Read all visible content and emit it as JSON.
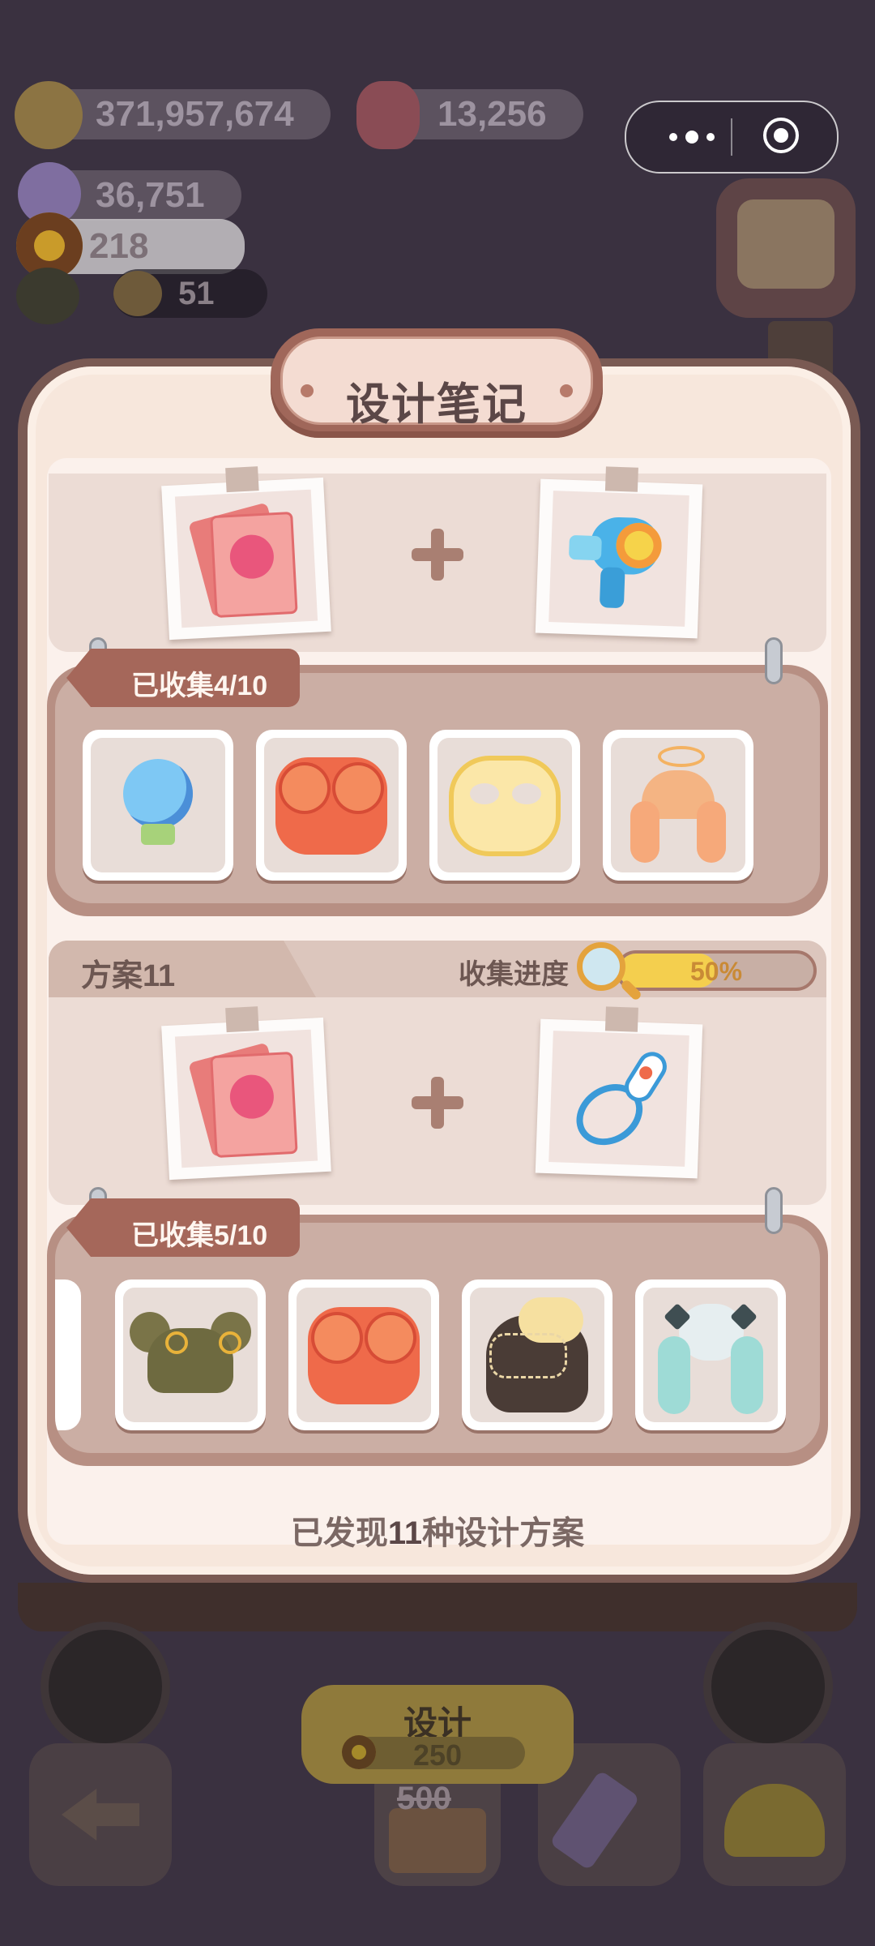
{
  "hud": {
    "coins": "371,957,674",
    "hearts": "13,256",
    "gems": "36,751",
    "sunflowers": "218",
    "small_count": "51"
  },
  "modal": {
    "title": "设计笔记",
    "footer_prefix": "已发现",
    "footer_count": "11",
    "footer_suffix": "种设计方案"
  },
  "recipes": [
    {
      "collected_label": "已收集4/10",
      "collected": 4,
      "total": 10,
      "ingredient_a_icon": "yep-photo-cards-icon",
      "ingredient_b_icon": "candy-blow-dryer-icon",
      "items": [
        "bulb-icon",
        "tomato-face-mask-icon",
        "popcorn-face-mask-icon",
        "halo-twin-tail-wig-icon"
      ]
    },
    {
      "title": "方案11",
      "progress_label": "收集进度",
      "progress_percent": 50,
      "progress_text": "50%",
      "collected_label": "已收集5/10",
      "collected": 5,
      "total": 10,
      "ingredient_a_icon": "yep-photo-cards-icon",
      "ingredient_b_icon": "whisk-icon",
      "items": [
        "olive-bun-wig-icon",
        "tomato-face-mask-icon",
        "black-net-wig-icon",
        "mint-twin-tail-wig-icon"
      ]
    }
  ],
  "design_button": {
    "label": "设计",
    "cost": "250",
    "original_cost": "500"
  },
  "colors": {
    "panel": "#f7e7dc",
    "frame": "#a0675a",
    "progress_fill": "#f4cf4e",
    "text_dark": "#5b4747"
  }
}
